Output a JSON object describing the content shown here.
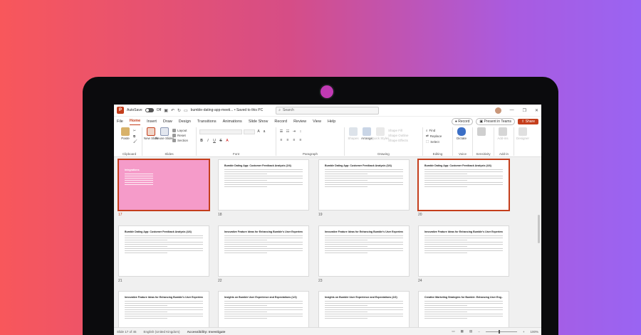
{
  "titlebar": {
    "autosave_label": "AutoSave",
    "autosave_state": "Off",
    "doc_title": "bumble-dating-app-meeti... • Saved to this PC",
    "search_placeholder": "Search"
  },
  "tabs": [
    "File",
    "Home",
    "Insert",
    "Draw",
    "Design",
    "Transitions",
    "Animations",
    "Slide Show",
    "Record",
    "Review",
    "View",
    "Help"
  ],
  "active_tab": "Home",
  "tab_actions": {
    "record": "Record",
    "present_teams": "Present in Teams",
    "share": "Share"
  },
  "ribbon": {
    "clipboard": {
      "paste": "Paste",
      "label": "Clipboard"
    },
    "slides": {
      "new_slide": "New Slide",
      "reuse_slides": "Reuse Slides",
      "layout": "Layout",
      "reset": "Reset",
      "section": "Section",
      "label": "Slides"
    },
    "font": {
      "label": "Font",
      "bold": "B",
      "italic": "I",
      "underline": "U",
      "strike": "S"
    },
    "paragraph": {
      "label": "Paragraph"
    },
    "drawing": {
      "shapes": "Shapes",
      "arrange": "Arrange",
      "quick_styles": "Quick Styles",
      "shape_fill": "Shape Fill",
      "shape_outline": "Shape Outline",
      "shape_effects": "Shape Effects",
      "label": "Drawing"
    },
    "editing": {
      "find": "Find",
      "replace": "Replace",
      "select": "Select",
      "label": "Editing"
    },
    "voice": {
      "dictate": "Dictate",
      "label": "Voice"
    },
    "sensitivity": {
      "label": "Sensitivity"
    },
    "addin": {
      "addins": "Add-ins",
      "label": "Add-in"
    },
    "designer": {
      "label": "Designer"
    }
  },
  "slides": [
    {
      "num": "17",
      "title": "Integrations",
      "style": "pink",
      "selected": true
    },
    {
      "num": "18",
      "title": "Bumble Dating App: Customer Feedback Analysis (2/4)"
    },
    {
      "num": "19",
      "title": "Bumble Dating App: Customer Feedback Analysis (3/4)"
    },
    {
      "num": "20",
      "title": "Bumble Dating App: Customer Feedback Analysis (4/4)",
      "selected": true
    },
    {
      "num": "21",
      "title": "Bumble Dating App: Customer Feedback Analysis (4/4)"
    },
    {
      "num": "22",
      "title": "Innovative Feature Ideas for Enhancing Bumble's User Experience (1/4)"
    },
    {
      "num": "23",
      "title": "Innovative Feature Ideas for Enhancing Bumble's User Experience (2/4)"
    },
    {
      "num": "24",
      "title": "Innovative Feature Ideas for Enhancing Bumble's User Experience (3/4)"
    },
    {
      "num": "",
      "title": "Innovative Feature Ideas for Enhancing Bumble's User Experience (4/4)"
    },
    {
      "num": "",
      "title": "Insights on Bumble User Experience and Expectations (1/2)"
    },
    {
      "num": "",
      "title": "Insights on Bumble User Experience and Expectations (2/2)"
    },
    {
      "num": "",
      "title": "Creative Marketing Strategies for Bumble: Enhancing User Eng... (1/3)"
    }
  ],
  "status": {
    "slide_counter": "Slide 17 of 45",
    "language": "English (United Kingdom)",
    "accessibility": "Accessibility: Investigate",
    "zoom": "100%"
  },
  "colors": {
    "accent": "#c43e1c",
    "pink_slide": "#f59bc9",
    "camera": "#c23ab4"
  }
}
